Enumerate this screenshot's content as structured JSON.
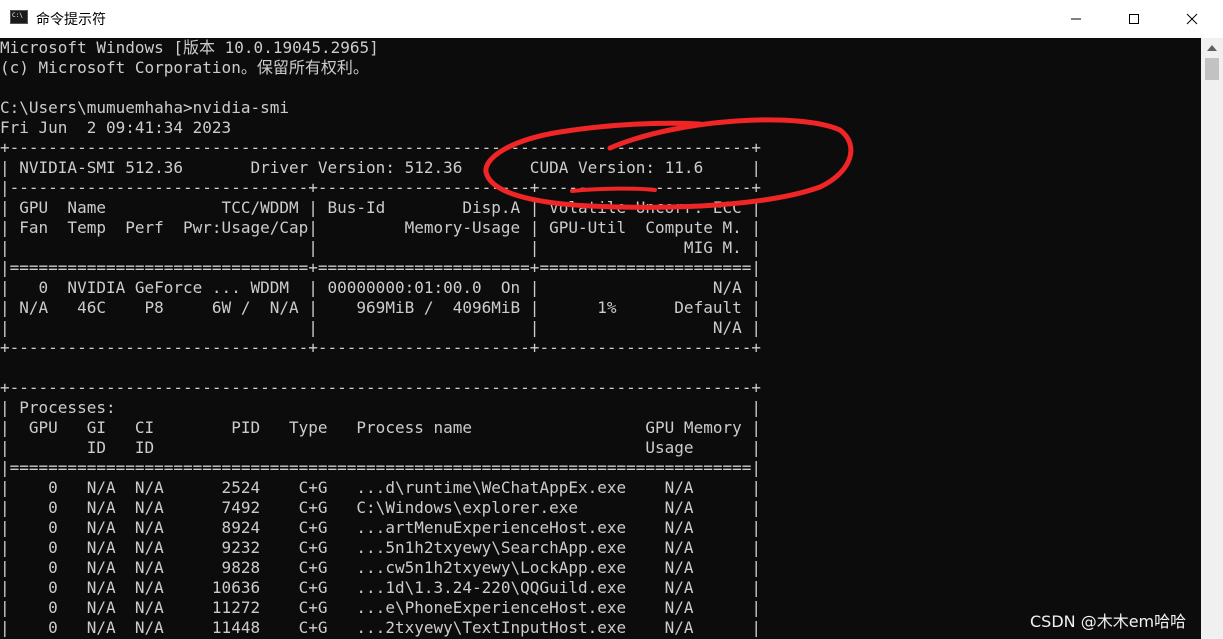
{
  "window": {
    "title": "命令提示符",
    "app_icon_text": "C:\\",
    "minimize_label": "minimize",
    "maximize_label": "maximize",
    "close_label": "close"
  },
  "console": {
    "lines": [
      "Microsoft Windows [版本 10.0.19045.2965]",
      "(c) Microsoft Corporation。保留所有权利。",
      "",
      "C:\\Users\\mumuemhaha>nvidia-smi",
      "Fri Jun  2 09:41:34 2023",
      "+-----------------------------------------------------------------------------+",
      "| NVIDIA-SMI 512.36       Driver Version: 512.36       CUDA Version: 11.6     |",
      "|-------------------------------+----------------------+----------------------+",
      "| GPU  Name            TCC/WDDM | Bus-Id        Disp.A | Volatile Uncorr. ECC |",
      "| Fan  Temp  Perf  Pwr:Usage/Cap|         Memory-Usage | GPU-Util  Compute M. |",
      "|                               |                      |               MIG M. |",
      "|===============================+======================+======================|",
      "|   0  NVIDIA GeForce ... WDDM  | 00000000:01:00.0  On |                  N/A |",
      "| N/A   46C    P8     6W /  N/A |    969MiB /  4096MiB |      1%      Default |",
      "|                               |                      |                  N/A |",
      "+-------------------------------+----------------------+----------------------+",
      "",
      "+-----------------------------------------------------------------------------+",
      "| Processes:                                                                  |",
      "|  GPU   GI   CI        PID   Type   Process name                  GPU Memory |",
      "|        ID   ID                                                   Usage      |",
      "|=============================================================================|",
      "|    0   N/A  N/A      2524    C+G   ...d\\runtime\\WeChatAppEx.exe    N/A      |",
      "|    0   N/A  N/A      7492    C+G   C:\\Windows\\explorer.exe         N/A      |",
      "|    0   N/A  N/A      8924    C+G   ...artMenuExperienceHost.exe    N/A      |",
      "|    0   N/A  N/A      9232    C+G   ...5n1h2txyewy\\SearchApp.exe    N/A      |",
      "|    0   N/A  N/A      9828    C+G   ...cw5n1h2txyewy\\LockApp.exe    N/A      |",
      "|    0   N/A  N/A     10636    C+G   ...1d\\1.3.24-220\\QQGuild.exe    N/A      |",
      "|    0   N/A  N/A     11272    C+G   ...e\\PhoneExperienceHost.exe    N/A      |",
      "|    0   N/A  N/A     11448    C+G   ...2txyewy\\TextInputHost.exe    N/A      |"
    ],
    "text_color": "#cccccc",
    "background": "#0c0c0c"
  },
  "annotation": {
    "color": "#f02525",
    "highlight": "CUDA Version: 11.6"
  },
  "watermark": {
    "text": "CSDN @木木em哈哈"
  }
}
